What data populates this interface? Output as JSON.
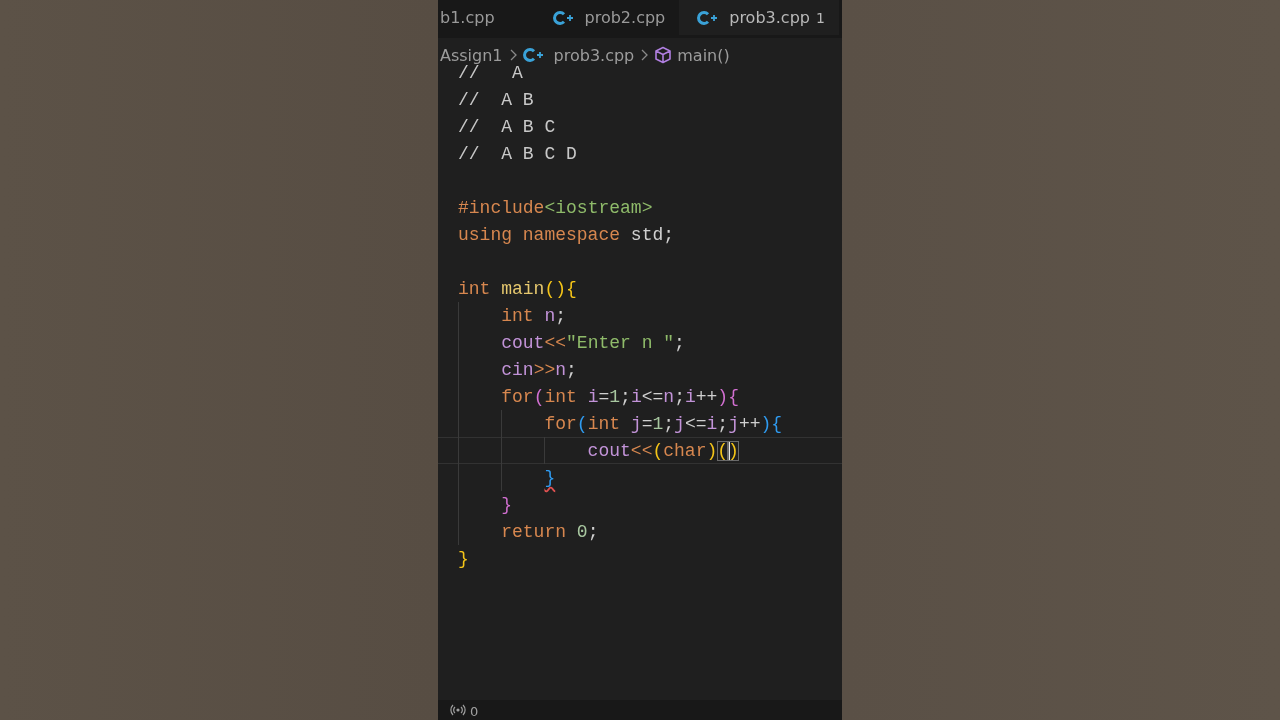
{
  "tabs": [
    {
      "label": "b1.cpp",
      "icon": false,
      "selected": false
    },
    {
      "label": "prob2.cpp",
      "icon": true,
      "selected": false
    },
    {
      "label": "prob3.cpp",
      "icon": true,
      "selected": true,
      "badge": "1"
    }
  ],
  "breadcrumb": [
    {
      "label": "Assign1",
      "kind": "folder"
    },
    {
      "label": "prob3.cpp",
      "kind": "file"
    },
    {
      "label": "main()",
      "kind": "symbol"
    }
  ],
  "code_lines": [
    {
      "current": false,
      "tokens": [
        {
          "text": "//   A",
          "kind": "comment"
        }
      ]
    },
    {
      "current": false,
      "tokens": [
        {
          "text": "//  A B",
          "kind": "comment"
        }
      ]
    },
    {
      "current": false,
      "tokens": [
        {
          "text": "//  A B C",
          "kind": "comment"
        }
      ]
    },
    {
      "current": false,
      "tokens": [
        {
          "text": "//  A B C D",
          "kind": "comment"
        }
      ]
    },
    {
      "current": false
    },
    {
      "current": false,
      "tokens": [
        {
          "text": "#include",
          "kind": "keyword"
        },
        {
          "text": "<iostream>",
          "kind": "string"
        }
      ]
    },
    {
      "current": false,
      "tokens": [
        {
          "text": "using namespace",
          "kind": "keyword"
        },
        {
          "text": " std;",
          "kind": "plain"
        }
      ]
    },
    {
      "current": false
    },
    {
      "current": false,
      "tokens": [
        {
          "text": "int",
          "kind": "keyword"
        },
        {
          "text": " main",
          "kind": "func"
        },
        {
          "text": "(){",
          "kind": "bracket1"
        }
      ]
    },
    {
      "current": false,
      "tokens": [
        {
          "text": "    int",
          "kind": "keyword"
        },
        {
          "text": " n",
          "kind": "var"
        },
        {
          "text": ";",
          "kind": "plain"
        }
      ]
    },
    {
      "current": false,
      "tokens": [
        {
          "text": "    cout",
          "kind": "var"
        },
        {
          "text": "<<",
          "kind": "keyword"
        },
        {
          "text": "\"Enter n \"",
          "kind": "string"
        },
        {
          "text": ";",
          "kind": "plain"
        }
      ]
    },
    {
      "current": false,
      "tokens": [
        {
          "text": "    cin",
          "kind": "var"
        },
        {
          "text": ">>",
          "kind": "keyword"
        },
        {
          "text": "n",
          "kind": "var"
        },
        {
          "text": ";",
          "kind": "plain"
        }
      ]
    },
    {
      "current": false,
      "tokens": [
        {
          "text": "    for",
          "kind": "keyword"
        },
        {
          "text": "(",
          "kind": "bracket2"
        },
        {
          "text": "int",
          "kind": "keyword"
        },
        {
          "text": " i",
          "kind": "var"
        },
        {
          "text": "=",
          "kind": "plain"
        },
        {
          "text": "1",
          "kind": "number"
        },
        {
          "text": ";",
          "kind": "plain"
        },
        {
          "text": "i",
          "kind": "var"
        },
        {
          "text": "<=",
          "kind": "plain"
        },
        {
          "text": "n",
          "kind": "var"
        },
        {
          "text": ";",
          "kind": "plain"
        },
        {
          "text": "i",
          "kind": "var"
        },
        {
          "text": "++",
          "kind": "plain"
        },
        {
          "text": "){",
          "kind": "bracket2"
        }
      ]
    },
    {
      "current": false,
      "tokens": [
        {
          "text": "        for",
          "kind": "keyword"
        },
        {
          "text": "(",
          "kind": "bracket3"
        },
        {
          "text": "int",
          "kind": "keyword"
        },
        {
          "text": " j",
          "kind": "var"
        },
        {
          "text": "=",
          "kind": "plain"
        },
        {
          "text": "1",
          "kind": "number"
        },
        {
          "text": ";",
          "kind": "plain"
        },
        {
          "text": "j",
          "kind": "var"
        },
        {
          "text": "<=",
          "kind": "plain"
        },
        {
          "text": "i",
          "kind": "var"
        },
        {
          "text": ";",
          "kind": "plain"
        },
        {
          "text": "j",
          "kind": "var"
        },
        {
          "text": "++",
          "kind": "plain"
        },
        {
          "text": "){",
          "kind": "bracket3"
        }
      ]
    },
    {
      "current": true,
      "tokens": [
        {
          "text": "            cout",
          "kind": "var"
        },
        {
          "text": "<<",
          "kind": "keyword"
        },
        {
          "text": "(",
          "kind": "bracket1"
        },
        {
          "text": "char",
          "kind": "keyword"
        },
        {
          "text": ")",
          "kind": "bracket1"
        },
        {
          "text": "(",
          "kind": "bracket-match"
        },
        {
          "text": ")",
          "kind": "bracket-match-caret"
        }
      ]
    },
    {
      "current": false,
      "tokens": [
        {
          "text": "        }",
          "kind": "bracket3-error"
        }
      ]
    },
    {
      "current": false,
      "tokens": [
        {
          "text": "    }",
          "kind": "bracket2"
        }
      ]
    },
    {
      "current": false,
      "tokens": [
        {
          "text": "    return",
          "kind": "keyword"
        },
        {
          "text": " 0",
          "kind": "number"
        },
        {
          "text": ";",
          "kind": "plain"
        }
      ]
    },
    {
      "current": false,
      "tokens": [
        {
          "text": "}",
          "kind": "bracket1"
        }
      ]
    }
  ],
  "status_bar": {
    "count": "0"
  }
}
